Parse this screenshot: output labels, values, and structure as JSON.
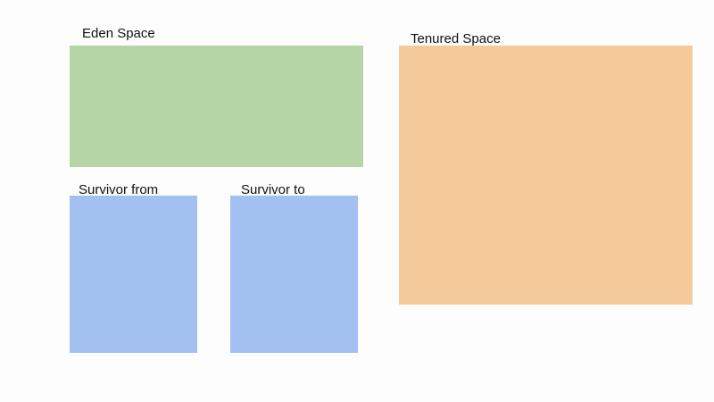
{
  "regions": {
    "eden": {
      "label": "Eden Space",
      "color": "#b6d5a7"
    },
    "survivor_from": {
      "label": "Survivor from",
      "color": "#a2c0f0"
    },
    "survivor_to": {
      "label": "Survivor to",
      "color": "#a2c0f0"
    },
    "tenured": {
      "label": "Tenured Space",
      "color": "#f5ca9b"
    }
  }
}
